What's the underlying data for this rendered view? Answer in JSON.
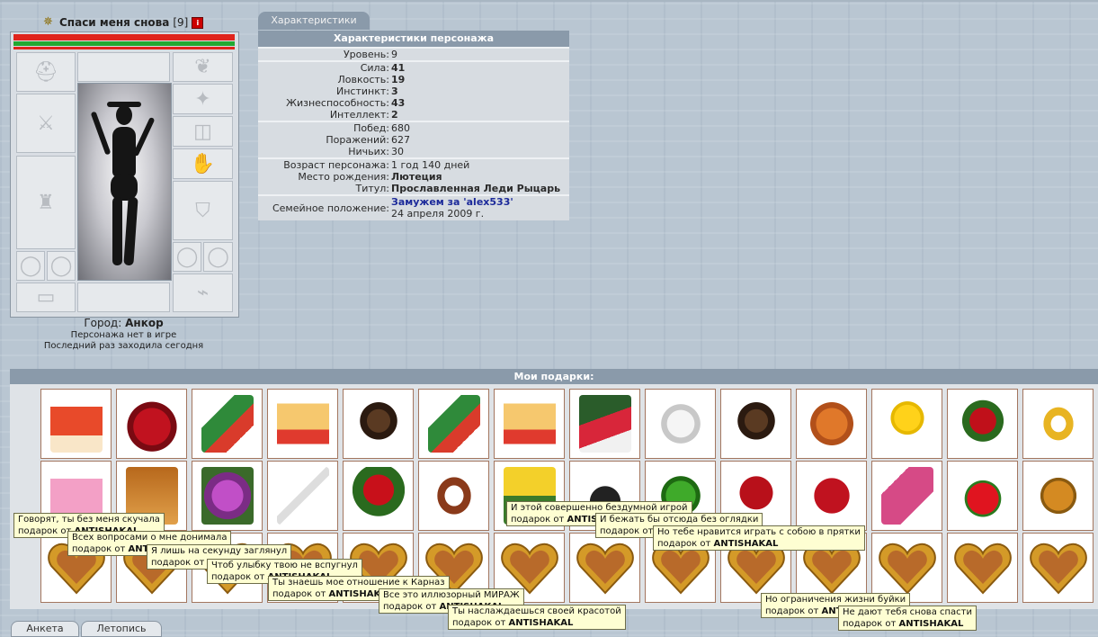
{
  "character": {
    "name": "Спаси меня снова",
    "level_badge": "[9]",
    "city_label": "Город:",
    "city": "Анкор",
    "status_offline": "Персонажа нет в игре",
    "last_visit": "Последний раз заходила сегодня"
  },
  "stats_tab": "Характеристики",
  "stats": {
    "title": "Характеристики персонажа",
    "groups": [
      [
        {
          "k": "Уровень:",
          "v": "9",
          "bold": false
        }
      ],
      [
        {
          "k": "Сила:",
          "v": "41",
          "bold": true
        },
        {
          "k": "Ловкость:",
          "v": "19",
          "bold": true
        },
        {
          "k": "Инстинкт:",
          "v": "3",
          "bold": true
        },
        {
          "k": "Жизнеспособность:",
          "v": "43",
          "bold": true
        },
        {
          "k": "Интеллект:",
          "v": "2",
          "bold": true
        }
      ],
      [
        {
          "k": "Побед:",
          "v": "680",
          "bold": false
        },
        {
          "k": "Поражений:",
          "v": "627",
          "bold": false
        },
        {
          "k": "Ничьих:",
          "v": "30",
          "bold": false
        }
      ],
      [
        {
          "k": "Возраст персонажа:",
          "v": "1 год 140 дней",
          "bold": false
        },
        {
          "k": "Место рождения:",
          "v": "Лютеция",
          "bold": true
        },
        {
          "k": "Титул:",
          "v": "Прославленная Леди Рыцарь",
          "bold": true
        }
      ]
    ],
    "marital": {
      "k": "Семейное положение:",
      "v": "Замужем за 'alex533'",
      "date": "24 апреля 2009 г."
    }
  },
  "gifts_title": "Мои подарки:",
  "gift_rows": [
    [
      "card-bear",
      "heart-strawberry",
      "card-girl",
      "card-pinup",
      "puppy",
      "card-girl",
      "card-pinup",
      "card-flowers",
      "angel-statue",
      "puppy",
      "kitten",
      "balloon",
      "rose-bouquet",
      "golden-ring"
    ],
    [
      "doll",
      "card-orange",
      "flower-violet",
      "dice",
      "roses-red",
      "bracelet",
      "card-daffodil",
      "bomb",
      "dragon-toy",
      "roses-bunch",
      "roses-heart",
      "gift-bag",
      "strawberry",
      "gold-coin"
    ],
    [
      "heart-frame",
      "heart-frame",
      "heart-frame",
      "heart-frame",
      "heart-frame",
      "heart-frame",
      "heart-frame",
      "heart-frame",
      "heart-frame",
      "heart-frame",
      "heart-frame",
      "heart-frame",
      "heart-frame",
      "heart-frame"
    ]
  ],
  "tooltips": [
    {
      "line1": "Говорят, ты без меня скучала",
      "from": "подарок от",
      "sender": "ANTISHAKAL"
    },
    {
      "line1": "Всех вопросами о мне донимала",
      "from": "подарок от",
      "sender": "ANTISHAKAL"
    },
    {
      "line1": "Я лишь на секунду заглянул",
      "from": "подарок от",
      "sender": "ANTISHAKAL"
    },
    {
      "line1": "Чтоб улыбку твою не вспугнул",
      "from": "подарок от",
      "sender": "ANTISHAKAL"
    },
    {
      "line1": "Ты знаешь мое отношение к Карназ",
      "from": "подарок от",
      "sender": "ANTISHAKAL"
    },
    {
      "line1": "Все это иллюзорный МИРАЖ",
      "from": "подарок от",
      "sender": "ANTISHAKAL"
    },
    {
      "line1": "Ты наслаждаешься своей красотой",
      "from": "подарок от",
      "sender": "ANTISHAKAL"
    },
    {
      "line1": "И этой совершенно бездумной игрой",
      "from": "подарок от",
      "sender": "ANTISHAKAL"
    },
    {
      "line1": "И бежать бы отсюда без оглядки",
      "from": "подарок от",
      "sender": "ANTISHAKAL"
    },
    {
      "line1": "Но тебе нравится играть с собою в прятки",
      "from": "подарок от",
      "sender": "ANTISHAKAL"
    },
    {
      "line1": "Но ограничения жизни буйки",
      "from": "подарок от",
      "sender": "ANTISHAKAL"
    },
    {
      "line1": "Не дают тебя снова спасти",
      "from": "подарок от",
      "sender": "ANTISHAKAL"
    }
  ],
  "bottom_tabs": [
    "Анкета",
    "Летопись"
  ],
  "colors": {
    "header_bar": "#8a9aaa",
    "married_link": "#1c2a9a",
    "tooltip_bg": "#fefed2",
    "hp": "#e0241c",
    "mana": "#22a832"
  }
}
